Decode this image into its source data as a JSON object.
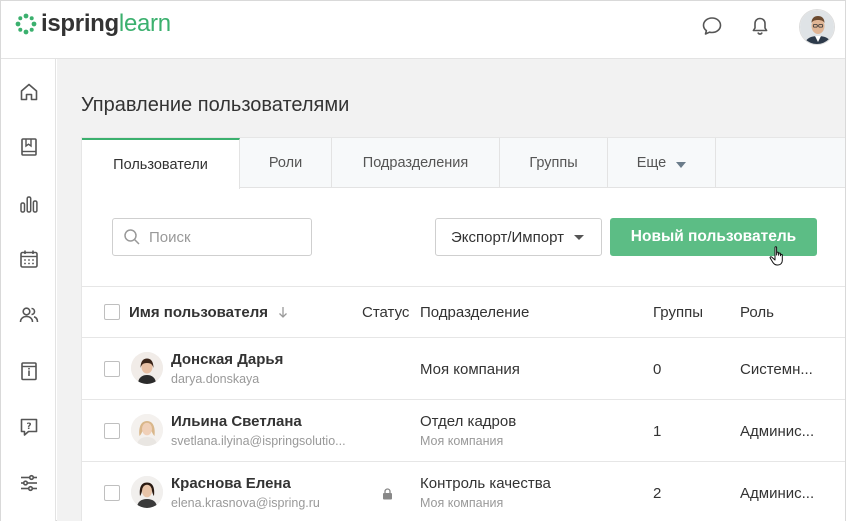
{
  "header": {
    "logo_part1": "ispring",
    "logo_part2": "learn",
    "icons": [
      "chat-icon",
      "bell-icon",
      "user-avatar"
    ]
  },
  "sidebar": {
    "items": [
      "home-icon",
      "courses-icon",
      "reports-icon",
      "calendar-icon",
      "users-icon",
      "info-icon",
      "help-icon",
      "settings-icon"
    ]
  },
  "page": {
    "title": "Управление пользователями"
  },
  "tabs": [
    {
      "label": "Пользователи"
    },
    {
      "label": "Роли"
    },
    {
      "label": "Подразделения"
    },
    {
      "label": "Группы"
    },
    {
      "label": "Еще"
    }
  ],
  "toolbar": {
    "search_placeholder": "Поиск",
    "export_label": "Экспорт/Импорт",
    "new_user_label": "Новый пользователь"
  },
  "table": {
    "columns": {
      "name": "Имя пользователя",
      "status": "Статус",
      "department": "Подразделение",
      "groups": "Группы",
      "role": "Роль"
    },
    "rows": [
      {
        "name": "Донская Дарья",
        "email": "darya.donskaya",
        "department": "Моя компания",
        "department_sub": "",
        "groups": "0",
        "role": "Системн...",
        "locked": false
      },
      {
        "name": "Ильина Светлана",
        "email": "svetlana.ilyina@ispringsolutio...",
        "department": "Отдел кадров",
        "department_sub": "Моя компания",
        "groups": "1",
        "role": "Админис...",
        "locked": false
      },
      {
        "name": "Краснова Елена",
        "email": "elena.krasnova@ispring.ru",
        "department": "Контроль качества",
        "department_sub": "Моя компания",
        "groups": "2",
        "role": "Админис...",
        "locked": true
      }
    ]
  },
  "colors": {
    "accent": "#3bb06e",
    "button_green": "#5cbd85",
    "background": "#f2f2f2"
  }
}
